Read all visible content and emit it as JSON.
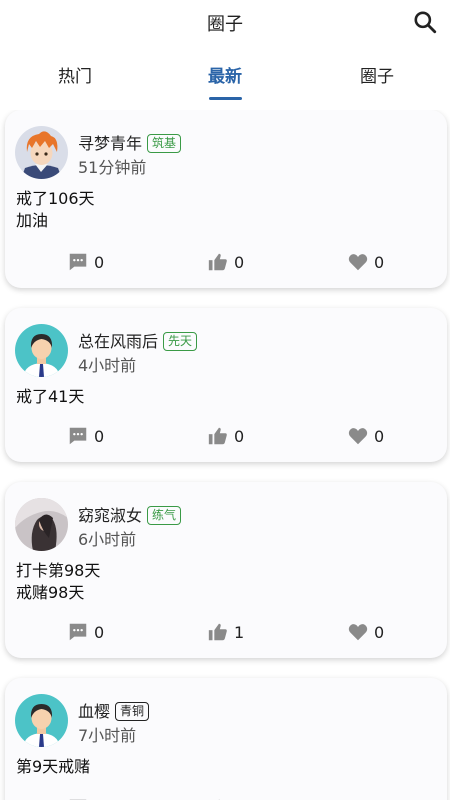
{
  "header": {
    "title": "圈子"
  },
  "tabs": [
    {
      "label": "热门"
    },
    {
      "label": "最新"
    },
    {
      "label": "圈子"
    }
  ],
  "active_tab": "最新",
  "posts": [
    {
      "username": "寻梦青年",
      "badge": "筑基",
      "time": "51分钟前",
      "content": "戒了106天\n加油",
      "comments": "0",
      "likes": "0",
      "favorites": "0"
    },
    {
      "username": "总在风雨后",
      "badge": "先天",
      "time": "4小时前",
      "content": "戒了41天",
      "comments": "0",
      "likes": "0",
      "favorites": "0"
    },
    {
      "username": "窈窕淑女",
      "badge": "练气",
      "time": "6小时前",
      "content": "打卡第98天\n戒赌98天",
      "comments": "0",
      "likes": "1",
      "favorites": "0"
    },
    {
      "username": "血樱",
      "badge": "青铜",
      "time": "7小时前",
      "content": "第9天戒赌",
      "comments": "",
      "likes": "",
      "favorites": ""
    }
  ],
  "colors": {
    "accent": "#2a64a8",
    "badge_green": "#3a9a46",
    "icon_gray": "#8a8a8a"
  }
}
